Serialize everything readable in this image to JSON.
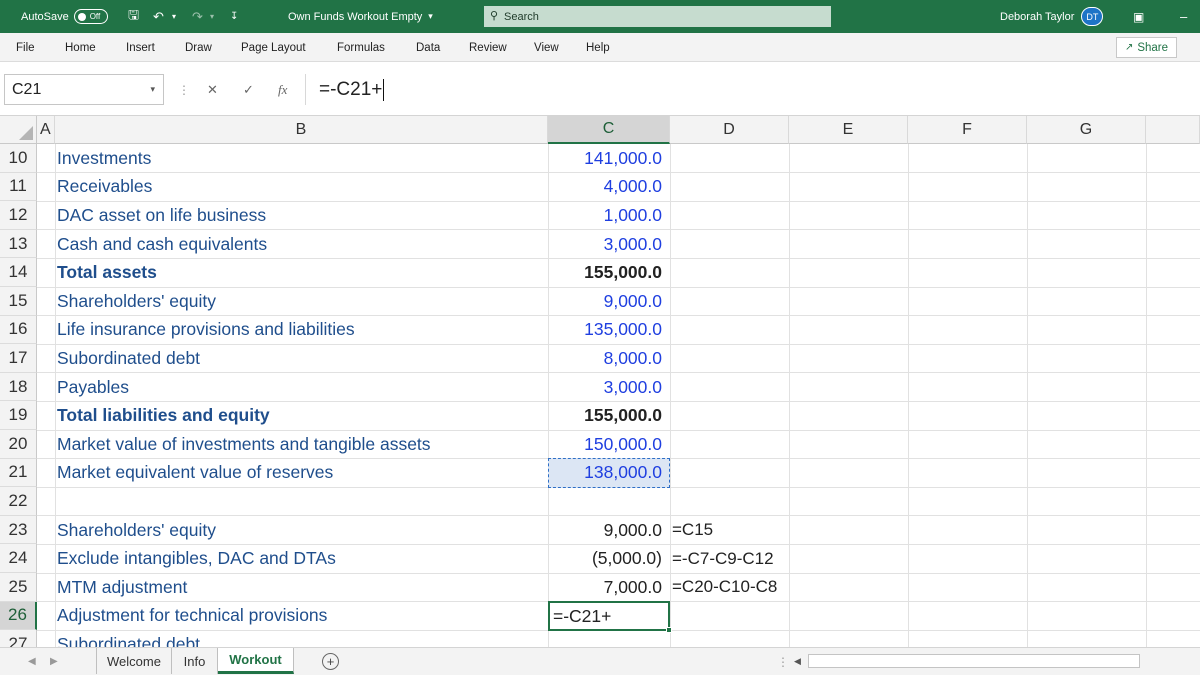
{
  "titlebar": {
    "autosave_label": "AutoSave",
    "autosave_state": "Off",
    "doc_title": "Own Funds Workout Empty",
    "doc_title_chevron": "▾",
    "search_placeholder": "Search",
    "user_name": "Deborah Taylor",
    "user_initials": "DT",
    "accent_color": "#217346"
  },
  "ribbon": {
    "tabs": [
      "File",
      "Home",
      "Insert",
      "Draw",
      "Page Layout",
      "Formulas",
      "Data",
      "Review",
      "View",
      "Help"
    ],
    "share_label": "Share"
  },
  "formula_bar": {
    "name_box": "C21",
    "fx_label": "fx",
    "formula": "=-C21+"
  },
  "grid": {
    "columns": [
      "A",
      "B",
      "C",
      "D",
      "E",
      "F",
      "G"
    ],
    "selected_column": "C",
    "selected_row": "26",
    "rows": [
      {
        "num": "10",
        "label": "Investments",
        "value": "141,000.0",
        "style": "input"
      },
      {
        "num": "11",
        "label": "Receivables",
        "value": "4,000.0",
        "style": "input"
      },
      {
        "num": "12",
        "label": "DAC asset on life business",
        "value": "1,000.0",
        "style": "input"
      },
      {
        "num": "13",
        "label": "Cash and cash equivalents",
        "value": "3,000.0",
        "style": "input"
      },
      {
        "num": "14",
        "label": "Total assets",
        "value": "155,000.0",
        "style": "total"
      },
      {
        "num": "15",
        "label": "Shareholders' equity",
        "value": "9,000.0",
        "style": "input"
      },
      {
        "num": "16",
        "label": "Life insurance provisions and liabilities",
        "value": "135,000.0",
        "style": "input"
      },
      {
        "num": "17",
        "label": "Subordinated debt",
        "value": "8,000.0",
        "style": "input"
      },
      {
        "num": "18",
        "label": "Payables",
        "value": "3,000.0",
        "style": "input"
      },
      {
        "num": "19",
        "label": "Total liabilities and equity",
        "value": "155,000.0",
        "style": "total"
      },
      {
        "num": "20",
        "label": "Market value of investments and tangible assets",
        "value": "150,000.0",
        "style": "input"
      },
      {
        "num": "21",
        "label": "Market equivalent value of reserves",
        "value": "138,000.0",
        "style": "input"
      },
      {
        "num": "22",
        "label": "",
        "value": "",
        "style": "input"
      },
      {
        "num": "23",
        "label": "Shareholders' equity",
        "value": "9,000.0",
        "style": "calc",
        "formula_text": "=C15"
      },
      {
        "num": "24",
        "label": "Exclude intangibles, DAC and DTAs",
        "value": "(5,000.0)",
        "style": "calc",
        "formula_text": "=-C7-C9-C12"
      },
      {
        "num": "25",
        "label": "MTM adjustment",
        "value": "7,000.0",
        "style": "calc",
        "formula_text": "=C20-C10-C8"
      },
      {
        "num": "26",
        "label": "Adjustment for technical provisions",
        "value": "",
        "style": "calc",
        "editing": "=-C21+"
      },
      {
        "num": "27",
        "label": "Subordinated debt",
        "value": "",
        "style": "input"
      }
    ]
  },
  "sheet_tabs": {
    "tabs": [
      "Welcome",
      "Info",
      "Workout"
    ],
    "active": "Workout",
    "add_label": "+"
  }
}
